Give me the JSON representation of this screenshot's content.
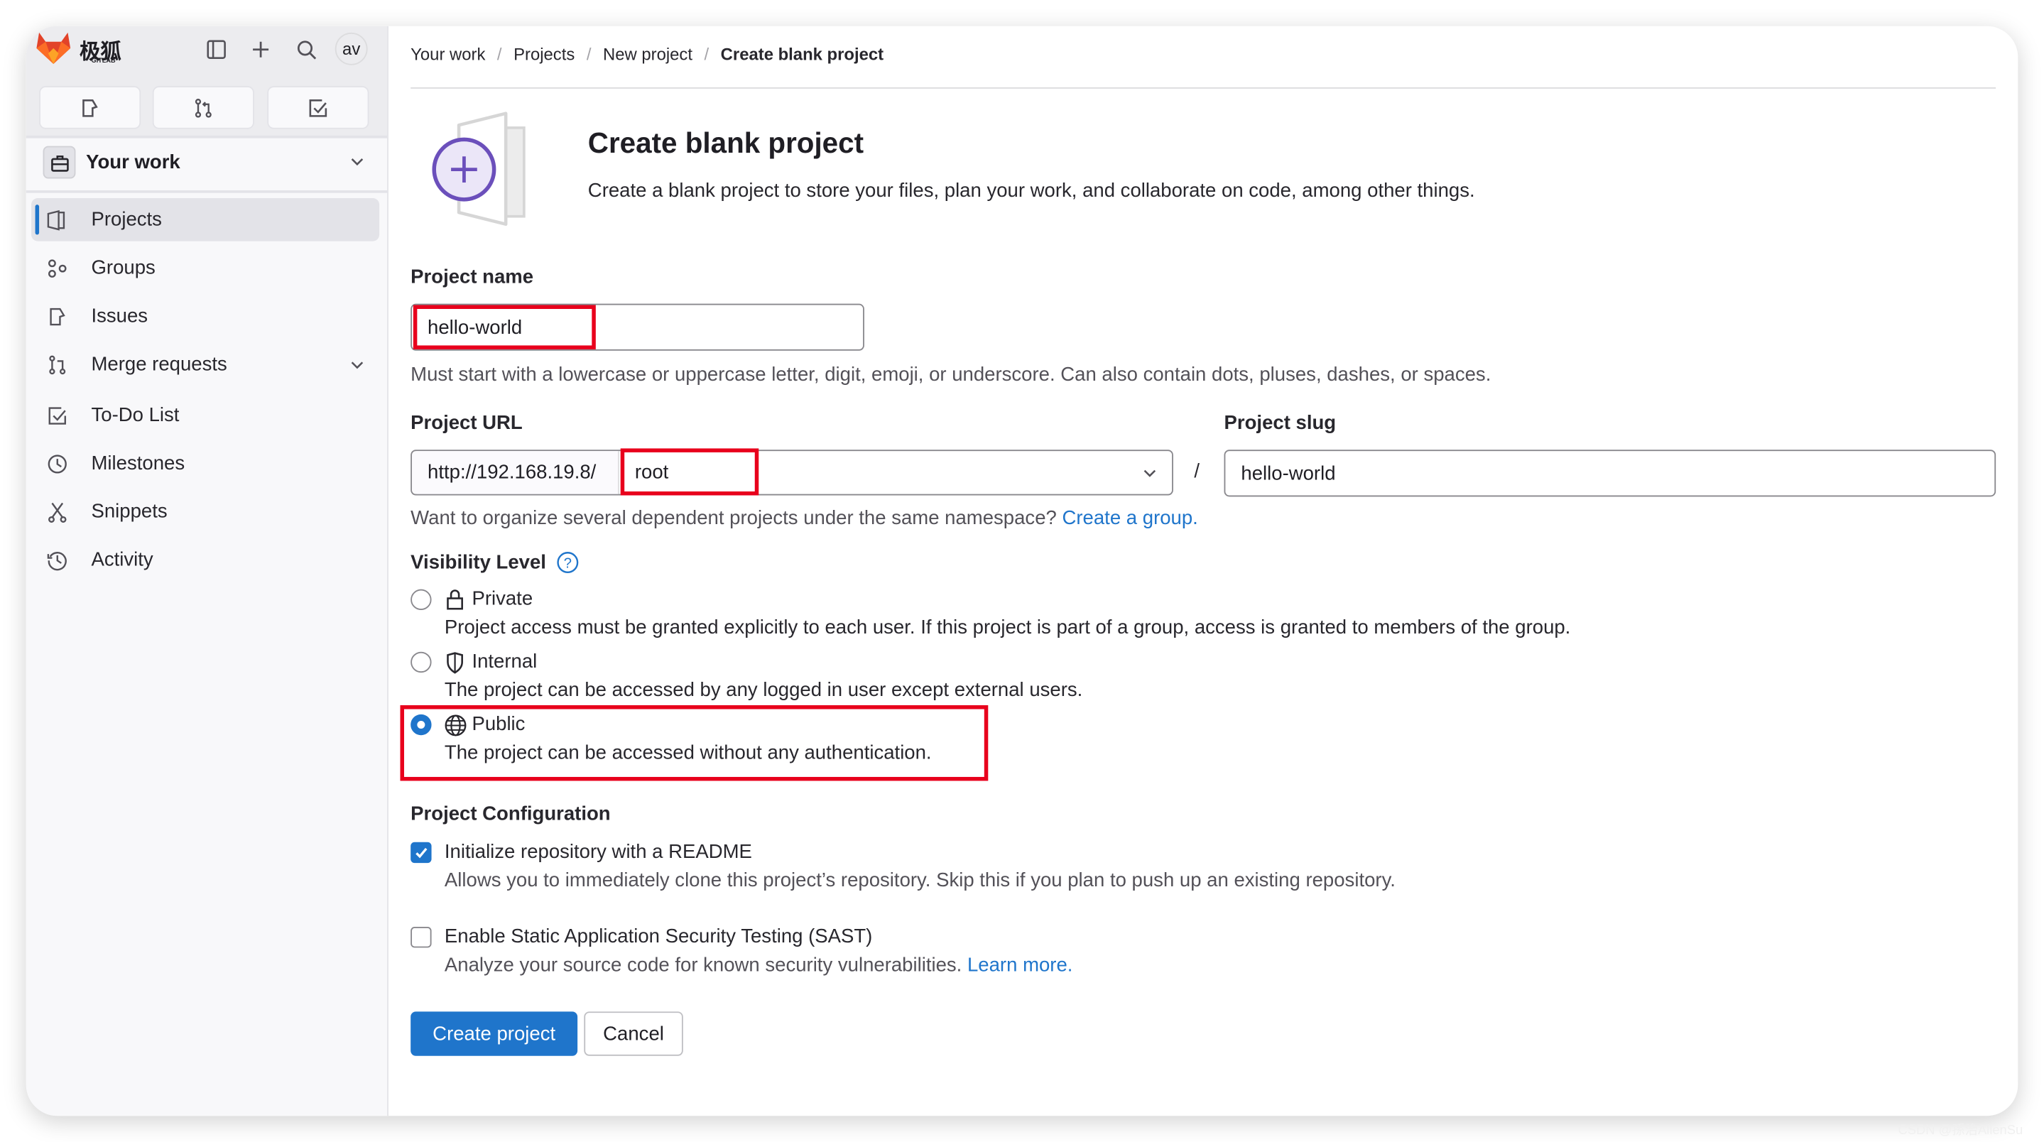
{
  "brand": {
    "logo_text": "极狐",
    "logo_subtext": "GITLAB"
  },
  "topbar": {
    "avatar": "av"
  },
  "sidebar": {
    "context": "Your work",
    "items": [
      {
        "label": "Projects",
        "icon": "project-icon",
        "active": true
      },
      {
        "label": "Groups",
        "icon": "group-icon"
      },
      {
        "label": "Issues",
        "icon": "issues-icon"
      },
      {
        "label": "Merge requests",
        "icon": "merge-request-icon"
      },
      {
        "label": "To-Do List",
        "icon": "todo-icon"
      },
      {
        "label": "Milestones",
        "icon": "clock-icon"
      },
      {
        "label": "Snippets",
        "icon": "snippet-icon"
      },
      {
        "label": "Activity",
        "icon": "history-icon"
      }
    ]
  },
  "breadcrumb": [
    "Your work",
    "Projects",
    "New project",
    "Create blank project"
  ],
  "header": {
    "title": "Create blank project",
    "description": "Create a blank project to store your files, plan your work, and collaborate on code, among other things."
  },
  "form": {
    "project_name_label": "Project name",
    "project_name_value": "hello-world",
    "project_name_help": "Must start with a lowercase or uppercase letter, digit, emoji, or underscore. Can also contain dots, pluses, dashes, or spaces.",
    "project_url_label": "Project URL",
    "url_prefix": "http://192.168.19.8/",
    "namespace_value": "root",
    "separator": "/",
    "project_slug_label": "Project slug",
    "project_slug_value": "hello-world",
    "group_help": "Want to organize several dependent projects under the same namespace?",
    "group_link": "Create a group.",
    "visibility_label": "Visibility Level",
    "visibility": [
      {
        "label": "Private",
        "description": "Project access must be granted explicitly to each user. If this project is part of a group, access is granted to members of the group.",
        "selected": false
      },
      {
        "label": "Internal",
        "description": "The project can be accessed by any logged in user except external users.",
        "selected": false
      },
      {
        "label": "Public",
        "description": "The project can be accessed without any authentication.",
        "selected": true
      }
    ],
    "config_label": "Project Configuration",
    "readme_label": "Initialize repository with a README",
    "readme_checked": true,
    "readme_help": "Allows you to immediately clone this project’s repository. Skip this if you plan to push up an existing repository.",
    "sast_label": "Enable Static Application Security Testing (SAST)",
    "sast_checked": false,
    "sast_help": "Analyze your source code for known security vulnerabilities.",
    "sast_link": "Learn more.",
    "create_button": "Create project",
    "cancel_button": "Cancel"
  },
  "watermark": "CSDN @孫治AllenSu",
  "colors": {
    "accent": "#1f75cb",
    "highlight": "#e8001c",
    "illustration": "#6b4fbb"
  }
}
